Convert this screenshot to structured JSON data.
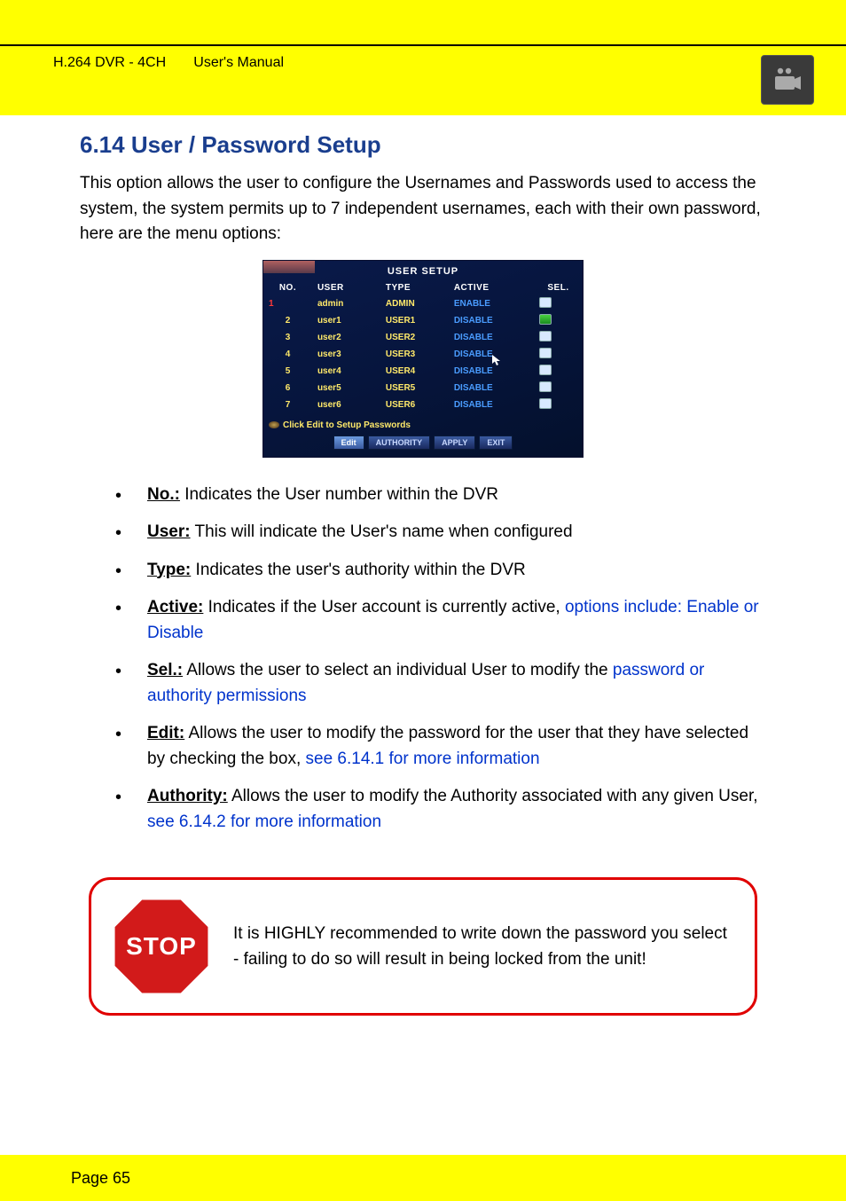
{
  "header": {
    "meta_line": "H.264 DVR - 4CH       User's Manual"
  },
  "section": {
    "number": "6.14",
    "title": "User / Password Setup",
    "lead": "This option allows the user to configure the Usernames and Passwords used to access the system, the system permits up to 7 independent usernames, each with their own password, here are the menu options:"
  },
  "dvr": {
    "title": "USER SETUP",
    "columns": {
      "no": "NO.",
      "user": "USER",
      "type": "TYPE",
      "active": "ACTIVE",
      "sel": "SEL."
    },
    "rows": [
      {
        "no": "1",
        "user": "admin",
        "type": "ADMIN",
        "active": "ENABLE",
        "sel": false,
        "selected_row": true
      },
      {
        "no": "2",
        "user": "user1",
        "type": "USER1",
        "active": "DISABLE",
        "sel": true,
        "selected_row": false
      },
      {
        "no": "3",
        "user": "user2",
        "type": "USER2",
        "active": "DISABLE",
        "sel": false,
        "selected_row": false
      },
      {
        "no": "4",
        "user": "user3",
        "type": "USER3",
        "active": "DISABLE",
        "sel": false,
        "selected_row": false
      },
      {
        "no": "5",
        "user": "user4",
        "type": "USER4",
        "active": "DISABLE",
        "sel": false,
        "selected_row": false
      },
      {
        "no": "6",
        "user": "user5",
        "type": "USER5",
        "active": "DISABLE",
        "sel": false,
        "selected_row": false
      },
      {
        "no": "7",
        "user": "user6",
        "type": "USER6",
        "active": "DISABLE",
        "sel": false,
        "selected_row": false
      }
    ],
    "hint": "Click Edit to Setup Passwords",
    "buttons": {
      "edit": "Edit",
      "authority": "AUTHORITY",
      "apply": "APPLY",
      "exit": "EXIT"
    }
  },
  "defs": [
    {
      "term": "No.:",
      "body_plain": " Indicates the User number within the DVR",
      "body_colored": ""
    },
    {
      "term": "User:",
      "body_plain": " This will indicate the User's name when configured",
      "body_colored": ""
    },
    {
      "term": "Type:",
      "body_plain": " Indicates the user's authority within the DVR",
      "body_colored": ""
    },
    {
      "term": "Active:",
      "body_plain": " Indicates if the User account is currently active, ",
      "body_colored": "options include: Enable or Disable"
    },
    {
      "term": "Sel.:",
      "body_plain": " Allows the user to select an individual User to modify the ",
      "body_colored": "password or authority permissions"
    },
    {
      "term": "Edit:",
      "body_plain": " Allows the user to modify the password for the user that they have selected by checking the box, ",
      "body_colored": "see 6.14.1 for more information"
    },
    {
      "term": "Authority:",
      "body_plain": " Allows the user to modify the Authority associated with any given User, ",
      "body_colored": "see 6.14.2 for more information"
    }
  ],
  "stop": {
    "label": "STOP",
    "msg": "It is HIGHLY recommended to write down the password you select - failing to do so will result in being locked from the unit!"
  },
  "footer": {
    "page_label": "Page 65"
  }
}
